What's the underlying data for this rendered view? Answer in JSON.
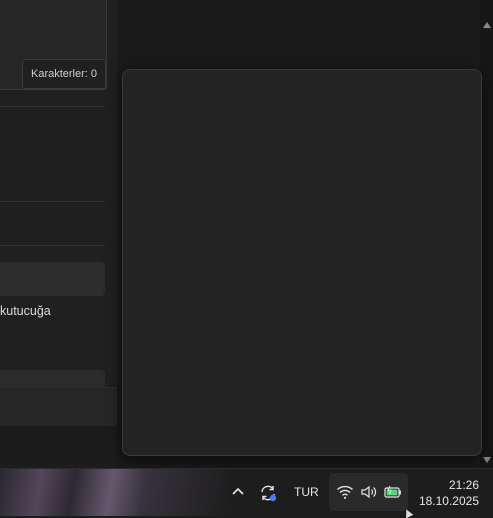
{
  "editor": {
    "character_counter": "Karakterler: 0",
    "hint_text": "kutucuğa"
  },
  "taskbar": {
    "language": "TUR",
    "time": "21:26",
    "date": "18.10.2025",
    "tray_icons": [
      "chevron-up-icon",
      "sync-icon",
      "wifi-icon",
      "volume-icon",
      "battery-icon"
    ]
  },
  "colors": {
    "sync_badge": "#3b82f6",
    "battery_fill": "#4ade80"
  }
}
